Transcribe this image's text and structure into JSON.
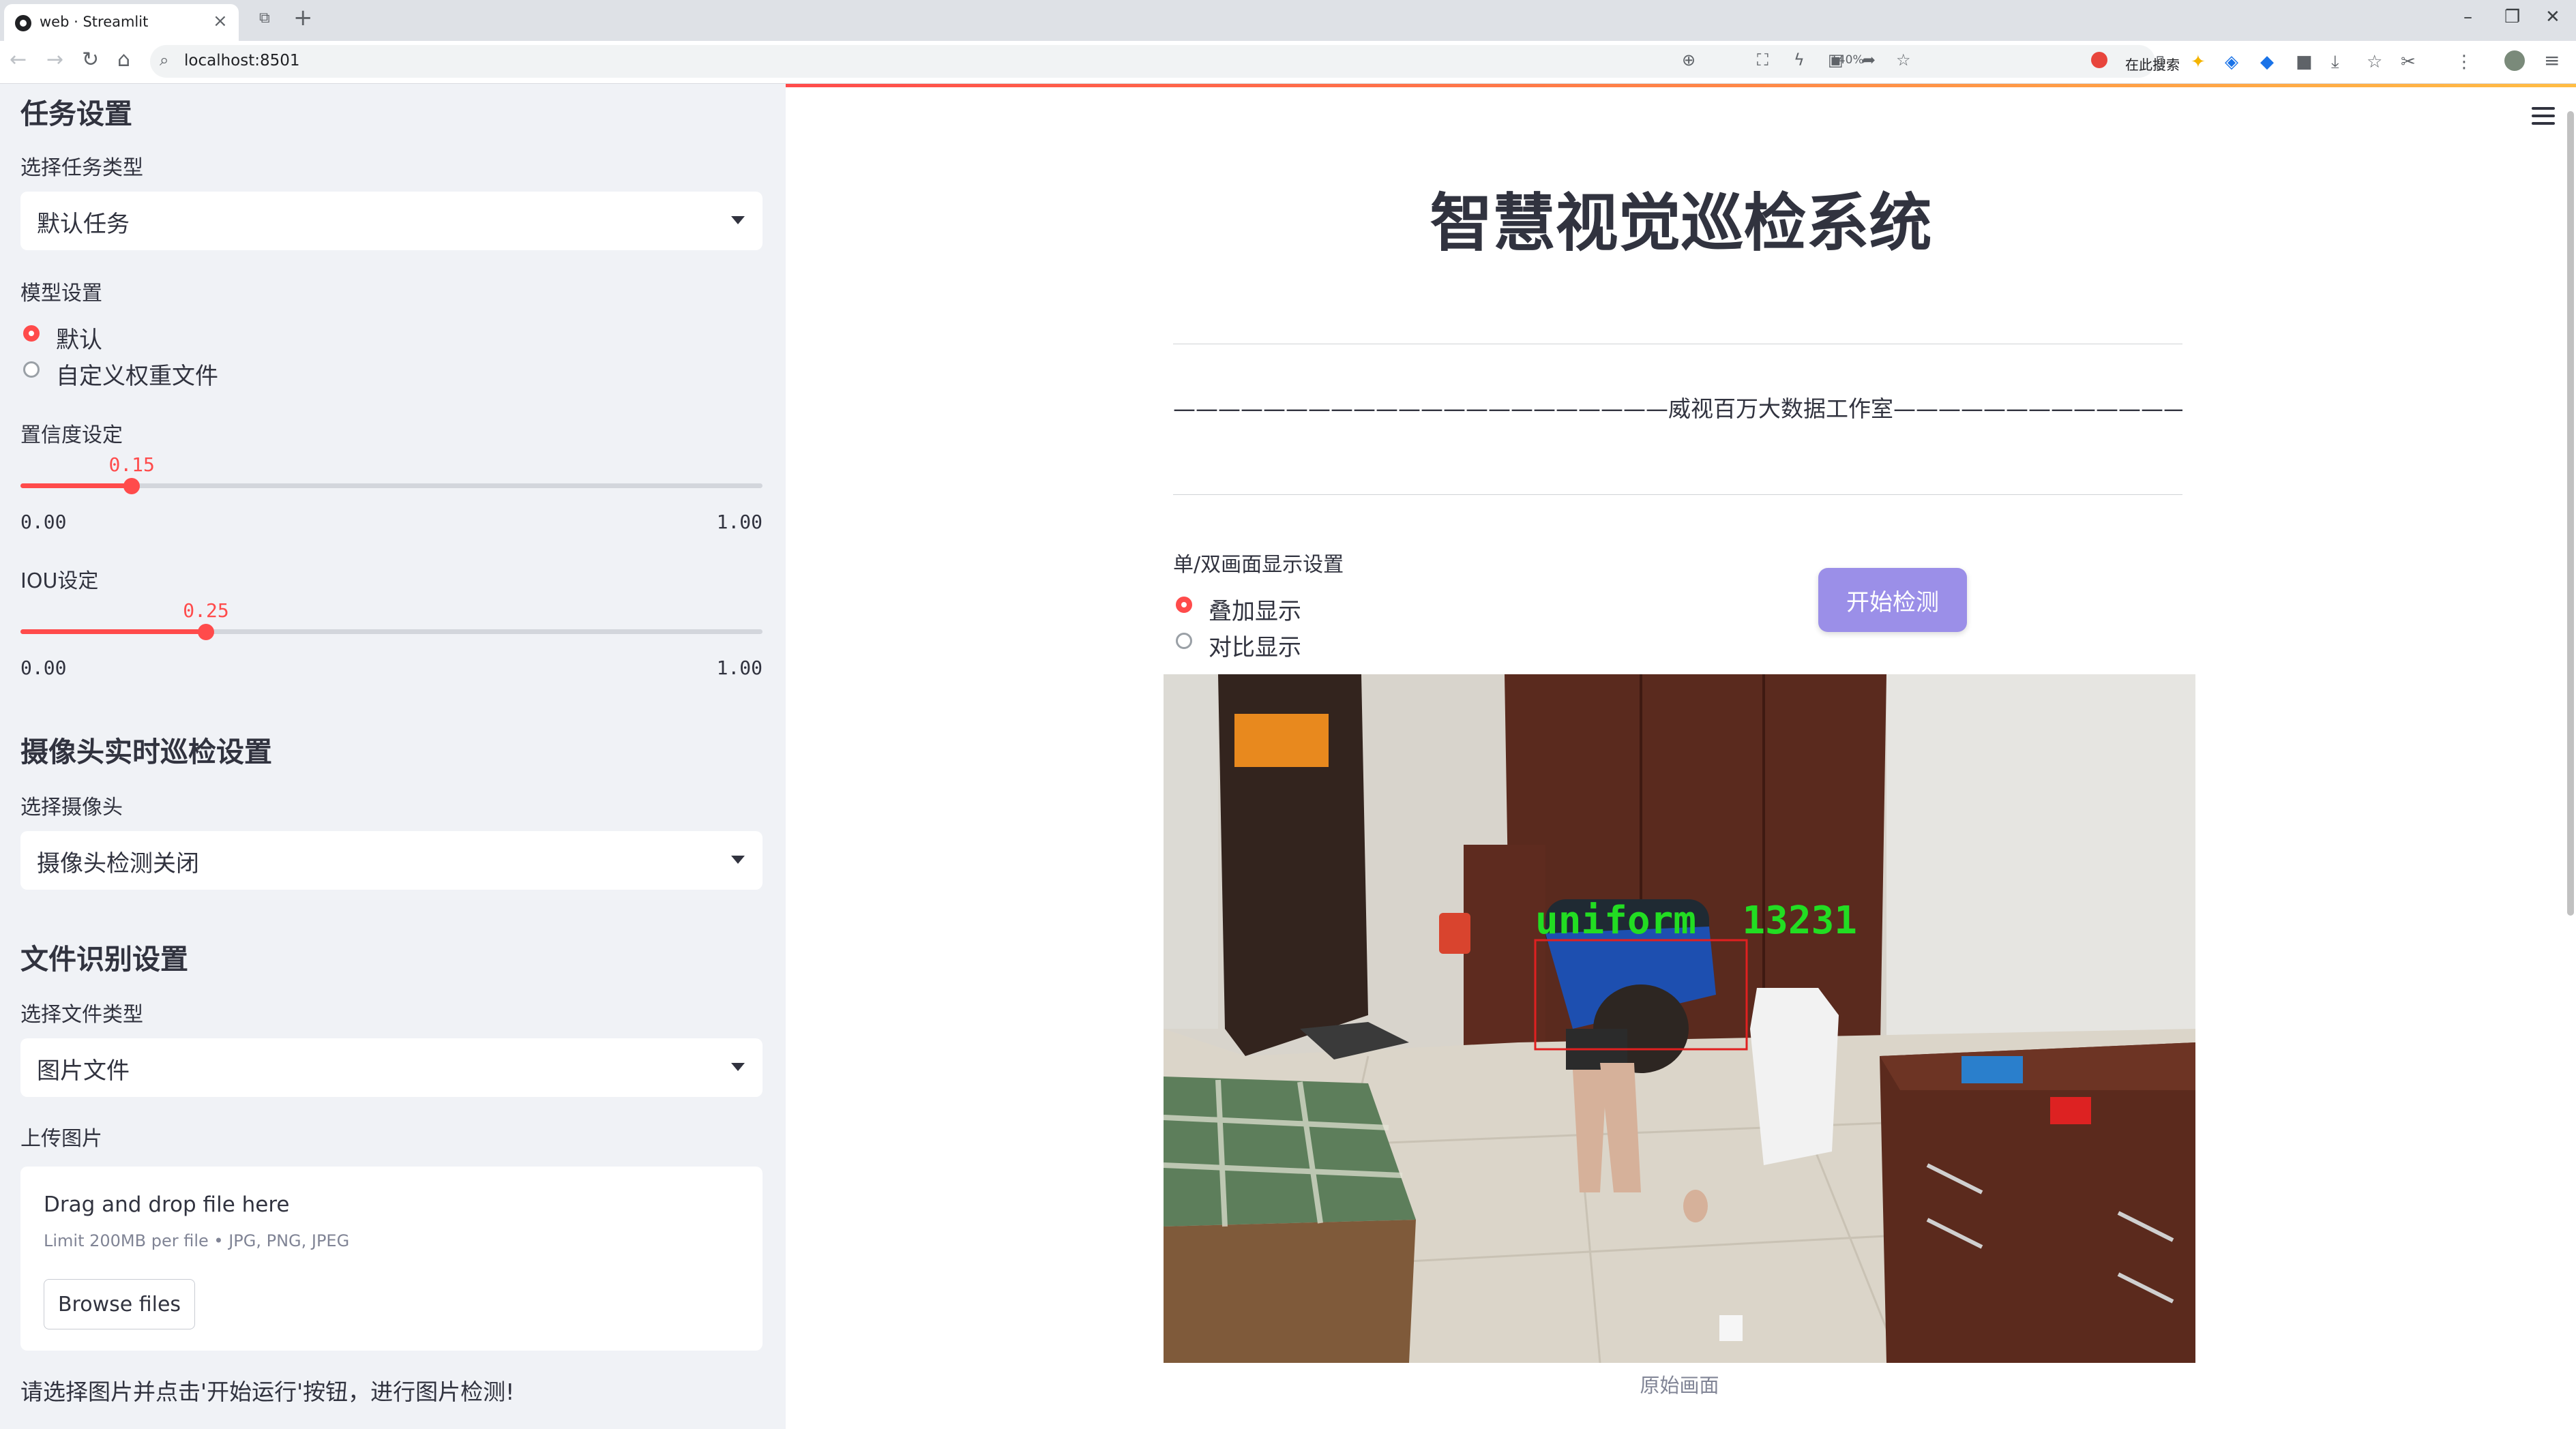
{
  "browser": {
    "tab_title": "web · Streamlit",
    "url": "localhost:8501",
    "zoom": "140%",
    "search_placeholder": "在此搜索"
  },
  "sidebar": {
    "task_section": "任务设置",
    "task_type_label": "选择任务类型",
    "task_type_value": "默认任务",
    "model_label": "模型设置",
    "model_options": [
      "默认",
      "自定义权重文件"
    ],
    "model_selected": 0,
    "conf_label": "置信度设定",
    "conf": {
      "value": 0.15,
      "display": "0.15",
      "min": "0.00",
      "max": "1.00",
      "min_v": 0,
      "max_v": 1
    },
    "iou_label": "IOU设定",
    "iou": {
      "value": 0.25,
      "display": "0.25",
      "min": "0.00",
      "max": "1.00",
      "min_v": 0,
      "max_v": 1
    },
    "camera_section": "摄像头实时巡检设置",
    "camera_label": "选择摄像头",
    "camera_value": "摄像头检测关闭",
    "file_section": "文件识别设置",
    "file_type_label": "选择文件类型",
    "file_type_value": "图片文件",
    "upload_label": "上传图片",
    "upload": {
      "title": "Drag and drop file here",
      "limit": "Limit 200MB per file • JPG, PNG, JPEG",
      "button": "Browse files"
    },
    "hint": "请选择图片并点击'开始运行'按钮，进行图片检测!"
  },
  "main": {
    "title": "智慧视觉巡检系统",
    "studio": "——————————————————————威视百万大数据工作室———————————————————————",
    "display_label": "单/双画面显示设置",
    "display_options": [
      "叠加显示",
      "对比显示"
    ],
    "display_selected": 0,
    "start_button": "开始检测",
    "detection_label": "uniform  13231",
    "caption": "原始画面"
  },
  "colors": {
    "accent": "#ff4b4b",
    "start_button": "#9b8fe8",
    "detection_box": "#e02020",
    "detection_text": "#22dd22"
  }
}
